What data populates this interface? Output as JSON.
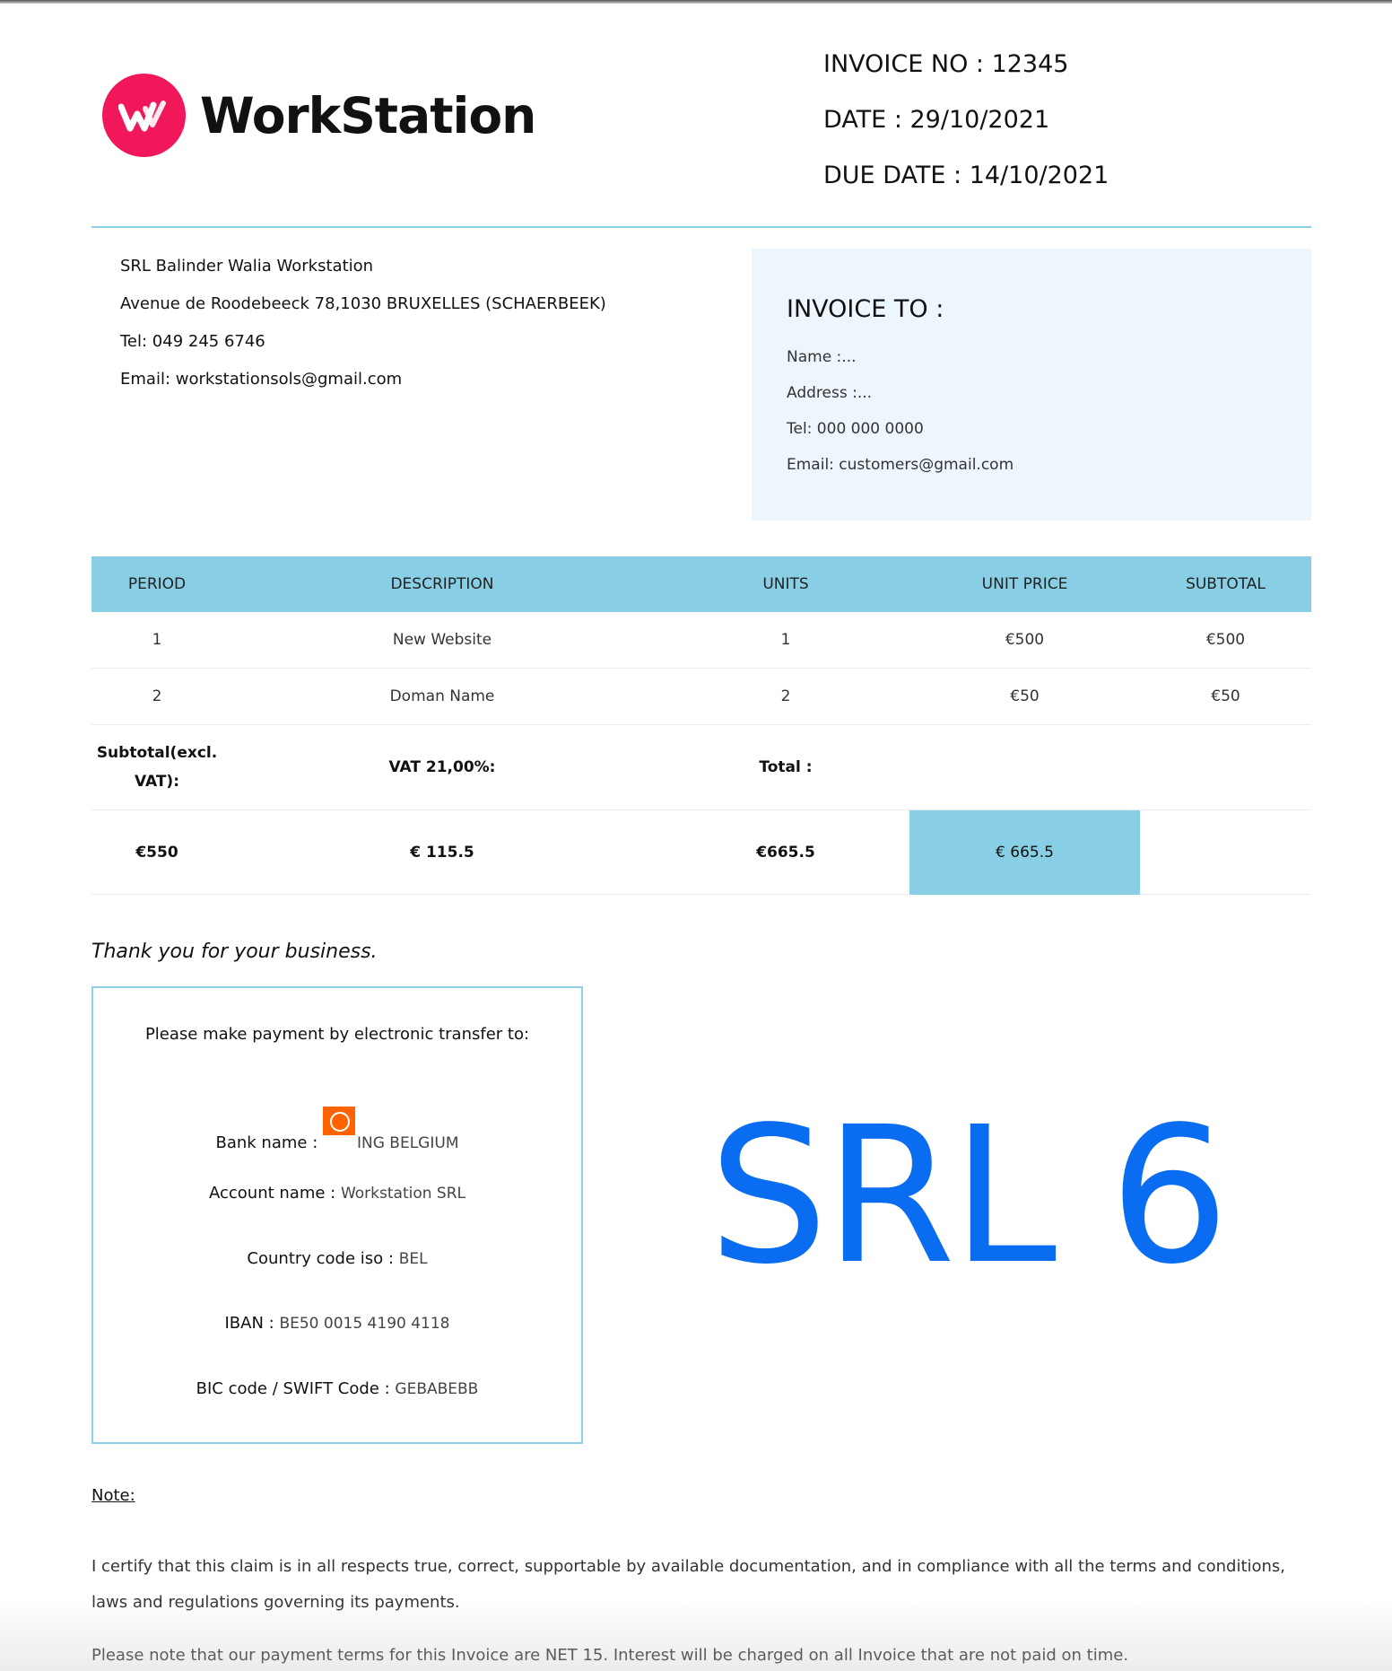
{
  "brand": {
    "name": "WorkStation",
    "accent": "#f0185a"
  },
  "invoice": {
    "number_line": "INVOICE NO : 12345",
    "date_line": "DATE : 29/10/2021",
    "due_line": "DUE DATE : 14/10/2021"
  },
  "company": {
    "name": "SRL Balinder Walia Workstation",
    "address": "Avenue de Roodebeeck 78,1030 BRUXELLES (SCHAERBEEK)",
    "tel": "Tel: 049 245 6746",
    "email": "Email: workstationsols@gmail.com"
  },
  "invoice_to": {
    "title": "INVOICE TO :",
    "name": "Name :...",
    "address": "Address :...",
    "tel": "Tel: 000 000 0000",
    "email": "Email: customers@gmail.com"
  },
  "table": {
    "headers": [
      "PERIOD",
      "DESCRIPTION",
      "UNITS",
      "UNIT PRICE",
      "SUBTOTAL"
    ],
    "rows": [
      [
        "1",
        "New Website",
        "1",
        "€500",
        "€500"
      ],
      [
        "2",
        "Doman Name",
        "2",
        "€50",
        "€50"
      ]
    ],
    "totals_labels": {
      "subtotal": "Subtotal(excl. VAT):",
      "vat": "VAT 21,00%:",
      "total": "Total :"
    },
    "totals_values": {
      "subtotal": "€550",
      "vat": "€ 115.5",
      "total": "€665.5",
      "grand": "€ 665.5"
    },
    "header_color": "#88cfe6"
  },
  "thanks": "Thank you for your business.",
  "payment": {
    "title": "Please make payment by electronic transfer to:",
    "bank_label": "Bank name :",
    "bank_value": "ING BELGIUM",
    "account_label": "Account name :",
    "account_value": "Workstation SRL",
    "country_label": "Country code iso :",
    "country_value": "BEL",
    "iban_label": "IBAN :",
    "iban_value": "BE50 0015 4190 4118",
    "bic_label": "BIC code / SWIFT Code :",
    "bic_value": "GEBABEBB",
    "bank_icon": "ing-lion-icon"
  },
  "stamp": {
    "text": "SRL 6",
    "color": "#0a6cf0"
  },
  "note": {
    "heading": "Note:",
    "paragraph1": "I certify that this claim is in all respects true, correct, supportable by available documentation, and in compliance with all the terms and conditions, laws and regulations governing its payments.",
    "paragraph2": "Please note that our payment terms for this Invoice are NET 15. Interest will be charged on all Invoice that are not paid on time."
  }
}
